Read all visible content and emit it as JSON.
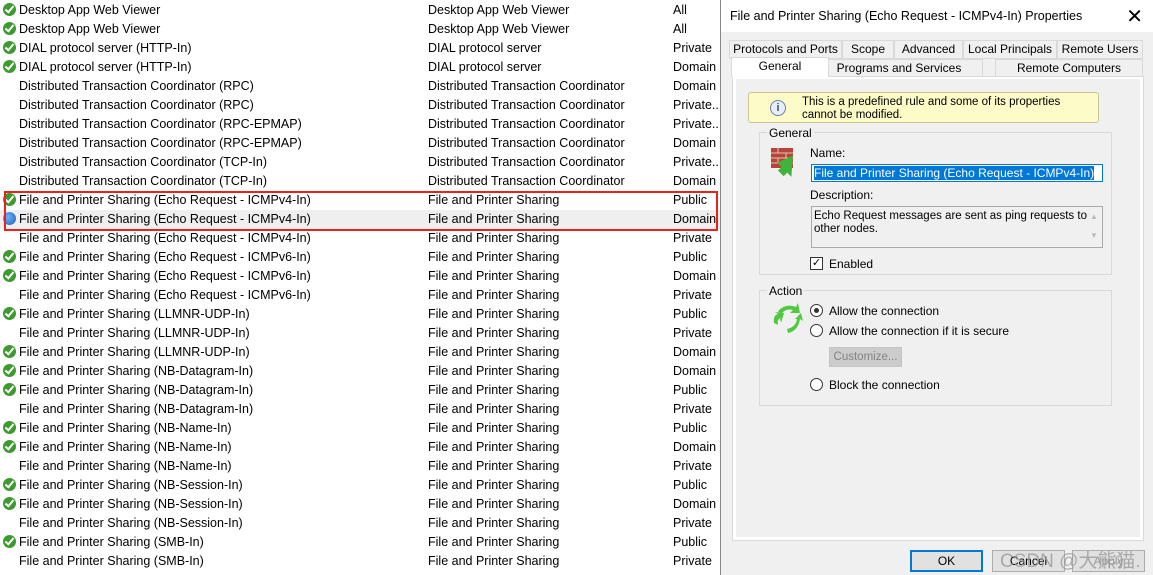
{
  "rules": [
    {
      "icon": "ok",
      "name": "Desktop App Web Viewer",
      "group": "Desktop App Web Viewer",
      "profile": "All"
    },
    {
      "icon": "ok",
      "name": "Desktop App Web Viewer",
      "group": "Desktop App Web Viewer",
      "profile": "All"
    },
    {
      "icon": "ok",
      "name": "DIAL protocol server (HTTP-In)",
      "group": "DIAL protocol server",
      "profile": "Private"
    },
    {
      "icon": "ok",
      "name": "DIAL protocol server (HTTP-In)",
      "group": "DIAL protocol server",
      "profile": "Domain"
    },
    {
      "icon": "",
      "name": "Distributed Transaction Coordinator (RPC)",
      "group": "Distributed Transaction Coordinator",
      "profile": "Domain"
    },
    {
      "icon": "",
      "name": "Distributed Transaction Coordinator (RPC)",
      "group": "Distributed Transaction Coordinator",
      "profile": "Private..."
    },
    {
      "icon": "",
      "name": "Distributed Transaction Coordinator (RPC-EPMAP)",
      "group": "Distributed Transaction Coordinator",
      "profile": "Private..."
    },
    {
      "icon": "",
      "name": "Distributed Transaction Coordinator (RPC-EPMAP)",
      "group": "Distributed Transaction Coordinator",
      "profile": "Domain"
    },
    {
      "icon": "",
      "name": "Distributed Transaction Coordinator (TCP-In)",
      "group": "Distributed Transaction Coordinator",
      "profile": "Private..."
    },
    {
      "icon": "",
      "name": "Distributed Transaction Coordinator (TCP-In)",
      "group": "Distributed Transaction Coordinator",
      "profile": "Domain"
    },
    {
      "icon": "ok",
      "name": "File and Printer Sharing (Echo Request - ICMPv4-In)",
      "group": "File and Printer Sharing",
      "profile": "Public"
    },
    {
      "icon": "glob",
      "name": "File and Printer Sharing (Echo Request - ICMPv4-In)",
      "group": "File and Printer Sharing",
      "profile": "Domain",
      "selected": true
    },
    {
      "icon": "",
      "name": "File and Printer Sharing (Echo Request - ICMPv4-In)",
      "group": "File and Printer Sharing",
      "profile": "Private"
    },
    {
      "icon": "ok",
      "name": "File and Printer Sharing (Echo Request - ICMPv6-In)",
      "group": "File and Printer Sharing",
      "profile": "Public"
    },
    {
      "icon": "ok",
      "name": "File and Printer Sharing (Echo Request - ICMPv6-In)",
      "group": "File and Printer Sharing",
      "profile": "Domain"
    },
    {
      "icon": "",
      "name": "File and Printer Sharing (Echo Request - ICMPv6-In)",
      "group": "File and Printer Sharing",
      "profile": "Private"
    },
    {
      "icon": "ok",
      "name": "File and Printer Sharing (LLMNR-UDP-In)",
      "group": "File and Printer Sharing",
      "profile": "Public"
    },
    {
      "icon": "",
      "name": "File and Printer Sharing (LLMNR-UDP-In)",
      "group": "File and Printer Sharing",
      "profile": "Private"
    },
    {
      "icon": "ok",
      "name": "File and Printer Sharing (LLMNR-UDP-In)",
      "group": "File and Printer Sharing",
      "profile": "Domain"
    },
    {
      "icon": "ok",
      "name": "File and Printer Sharing (NB-Datagram-In)",
      "group": "File and Printer Sharing",
      "profile": "Domain"
    },
    {
      "icon": "ok",
      "name": "File and Printer Sharing (NB-Datagram-In)",
      "group": "File and Printer Sharing",
      "profile": "Public"
    },
    {
      "icon": "",
      "name": "File and Printer Sharing (NB-Datagram-In)",
      "group": "File and Printer Sharing",
      "profile": "Private"
    },
    {
      "icon": "ok",
      "name": "File and Printer Sharing (NB-Name-In)",
      "group": "File and Printer Sharing",
      "profile": "Public"
    },
    {
      "icon": "ok",
      "name": "File and Printer Sharing (NB-Name-In)",
      "group": "File and Printer Sharing",
      "profile": "Domain"
    },
    {
      "icon": "",
      "name": "File and Printer Sharing (NB-Name-In)",
      "group": "File and Printer Sharing",
      "profile": "Private"
    },
    {
      "icon": "ok",
      "name": "File and Printer Sharing (NB-Session-In)",
      "group": "File and Printer Sharing",
      "profile": "Public"
    },
    {
      "icon": "ok",
      "name": "File and Printer Sharing (NB-Session-In)",
      "group": "File and Printer Sharing",
      "profile": "Domain"
    },
    {
      "icon": "",
      "name": "File and Printer Sharing (NB-Session-In)",
      "group": "File and Printer Sharing",
      "profile": "Private"
    },
    {
      "icon": "ok",
      "name": "File and Printer Sharing (SMB-In)",
      "group": "File and Printer Sharing",
      "profile": "Public"
    },
    {
      "icon": "",
      "name": "File and Printer Sharing (SMB-In)",
      "group": "File and Printer Sharing",
      "profile": "Private"
    }
  ],
  "dialog": {
    "title": "File and Printer Sharing (Echo Request - ICMPv4-In) Properties",
    "tabs_row1": [
      "Protocols and Ports",
      "Scope",
      "Advanced",
      "Local Principals",
      "Remote Users"
    ],
    "tabs_row2": [
      "General",
      "Programs and Services",
      "Remote Computers"
    ],
    "active_tab": "General",
    "info": "This is a predefined rule and some of its properties cannot be modified.",
    "general_legend": "General",
    "name_label": "Name:",
    "name_value": "File and Printer Sharing (Echo Request - ICMPv4-In)",
    "desc_label": "Description:",
    "desc_value": "Echo Request messages are sent as ping requests to other nodes.",
    "enabled_label": "Enabled",
    "enabled": true,
    "action_legend": "Action",
    "allow": "Allow the connection",
    "allow_secure": "Allow the connection if it is secure",
    "customize": "Customize...",
    "block": "Block the connection",
    "selected_action": "allow",
    "ok": "OK",
    "cancel": "Cancel",
    "apply": "Apply"
  },
  "watermark": "CSDN @大熊猫.",
  "colors": {
    "highlight": "#e8231f",
    "accent": "#0078d7",
    "check": "#3c9a2e"
  }
}
